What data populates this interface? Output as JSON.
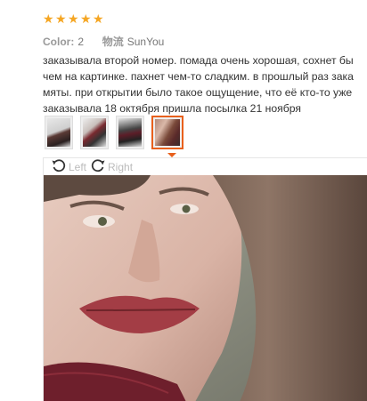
{
  "rating": {
    "stars": 5,
    "max": 5,
    "color": "#f5a623"
  },
  "meta": {
    "color_label": "Color:",
    "color_value": "2",
    "logistics_label": "物流",
    "logistics_value": "SunYou"
  },
  "review": {
    "lines": [
      "заказывала второй номер. помада очень хорошая, сохнет бы",
      "чем на картинке. пахнет чем-то сладким. в прошлый раз зака",
      "мяты. при открытии было такое ощущение, что её кто-то уже",
      "заказывала 18 октября пришла посылка 21 ноября"
    ]
  },
  "thumbnails": [
    {
      "name": "lipstick-photo-1",
      "active": false
    },
    {
      "name": "lipstick-photo-2",
      "active": false
    },
    {
      "name": "lipstick-photo-3",
      "active": false
    },
    {
      "name": "selfie-photo",
      "active": true
    }
  ],
  "viewer": {
    "rotate_left_label": "Left",
    "rotate_right_label": "Right"
  },
  "colors": {
    "accent": "#e8601c",
    "text": "#333333",
    "muted": "#888888"
  }
}
